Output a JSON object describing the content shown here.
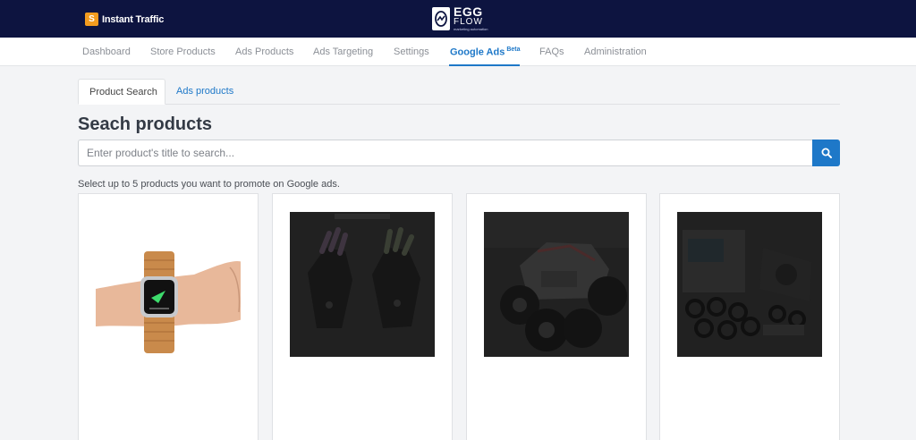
{
  "app": {
    "brand_initial": "S",
    "brand_name": "Instant Traffic",
    "logo_egg": "EGG",
    "logo_flow": "FLOW",
    "logo_tag": "marketing automation"
  },
  "nav": {
    "items": [
      {
        "label": "Dashboard"
      },
      {
        "label": "Store Products"
      },
      {
        "label": "Ads Products"
      },
      {
        "label": "Ads Targeting"
      },
      {
        "label": "Settings"
      },
      {
        "label": "Google Ads",
        "badge": "Beta"
      },
      {
        "label": "FAQs"
      },
      {
        "label": "Administration"
      }
    ],
    "active": "Google Ads"
  },
  "tabs": [
    {
      "label": "Product Search"
    },
    {
      "label": "Ads products"
    }
  ],
  "page": {
    "title": "Seach products",
    "search_placeholder": "Enter product's title to search...",
    "search_value": "",
    "hint": "Select up to 5 products you want to promote on Google ads."
  },
  "products": [
    {
      "image": "wooden-watch-on-wrist",
      "selected": false
    },
    {
      "image": "led-gloves-dimmed",
      "selected": false
    },
    {
      "image": "rc-monster-truck-dimmed",
      "selected": false
    },
    {
      "image": "phone-lens-kit-dimmed",
      "selected": false
    }
  ],
  "colors": {
    "topbar": "#0d1440",
    "accent": "#1e78c8",
    "brand_icon": "#f39c1f"
  }
}
